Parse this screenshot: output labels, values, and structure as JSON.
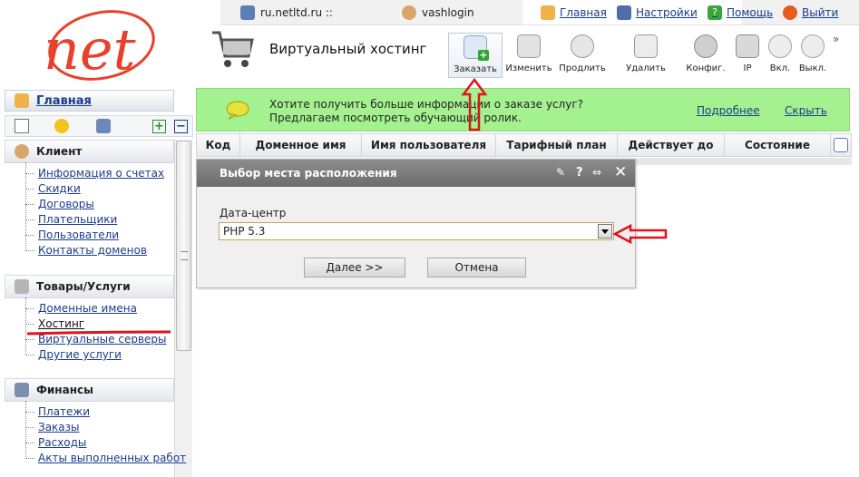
{
  "topbar": {
    "site": "ru.netltd.ru ::",
    "login": "vashlogin",
    "links": [
      {
        "label": "Главная",
        "icon": "home-icon"
      },
      {
        "label": "Настройки",
        "icon": "settings-icon"
      },
      {
        "label": "Помощь",
        "icon": "help-icon"
      },
      {
        "label": "Выйти",
        "icon": "power-icon"
      }
    ]
  },
  "logo": {
    "text": "net",
    "color": "#e8412b"
  },
  "page": {
    "title": "Виртуальный хостинг"
  },
  "toolbar": {
    "order": "Заказать",
    "edit": "Изменить",
    "extend": "Продлить",
    "delete": "Удалить",
    "config": "Конфиг.",
    "ip": "IP",
    "on": "Вкл.",
    "off": "Выкл."
  },
  "sidebar": {
    "home": "Главная",
    "sections": [
      {
        "title": "Клиент",
        "items": [
          "Информация о счетах",
          "Скидки",
          "Договоры",
          "Плательщики",
          "Пользователи",
          "Контакты доменов"
        ]
      },
      {
        "title": "Товары/Услуги",
        "items": [
          "Доменные имена",
          "Хостинг",
          "Виртуальные серверы",
          "Другие услуги"
        ]
      },
      {
        "title": "Финансы",
        "items": [
          "Платежи",
          "Заказы",
          "Расходы",
          "Акты выполненных работ"
        ]
      }
    ]
  },
  "banner": {
    "text": "Хотите получить больше информации о заказе услуг? Предлагаем посмотреть обучающий ролик.",
    "more": "Подробнее",
    "hide": "Скрыть",
    "bg": "#a4f18f"
  },
  "table": {
    "columns": [
      "Код",
      "Доменное имя",
      "Имя пользователя",
      "Тарифный план",
      "Действует до",
      "Состояние"
    ]
  },
  "dialog": {
    "title": "Выбор места расположения",
    "label": "Дата-центр",
    "selected": "PHP 5.3",
    "next": "Далее >>",
    "cancel": "Отмена"
  },
  "colors": {
    "accent": "#1a3c8c",
    "annotation": "#e0121b"
  }
}
